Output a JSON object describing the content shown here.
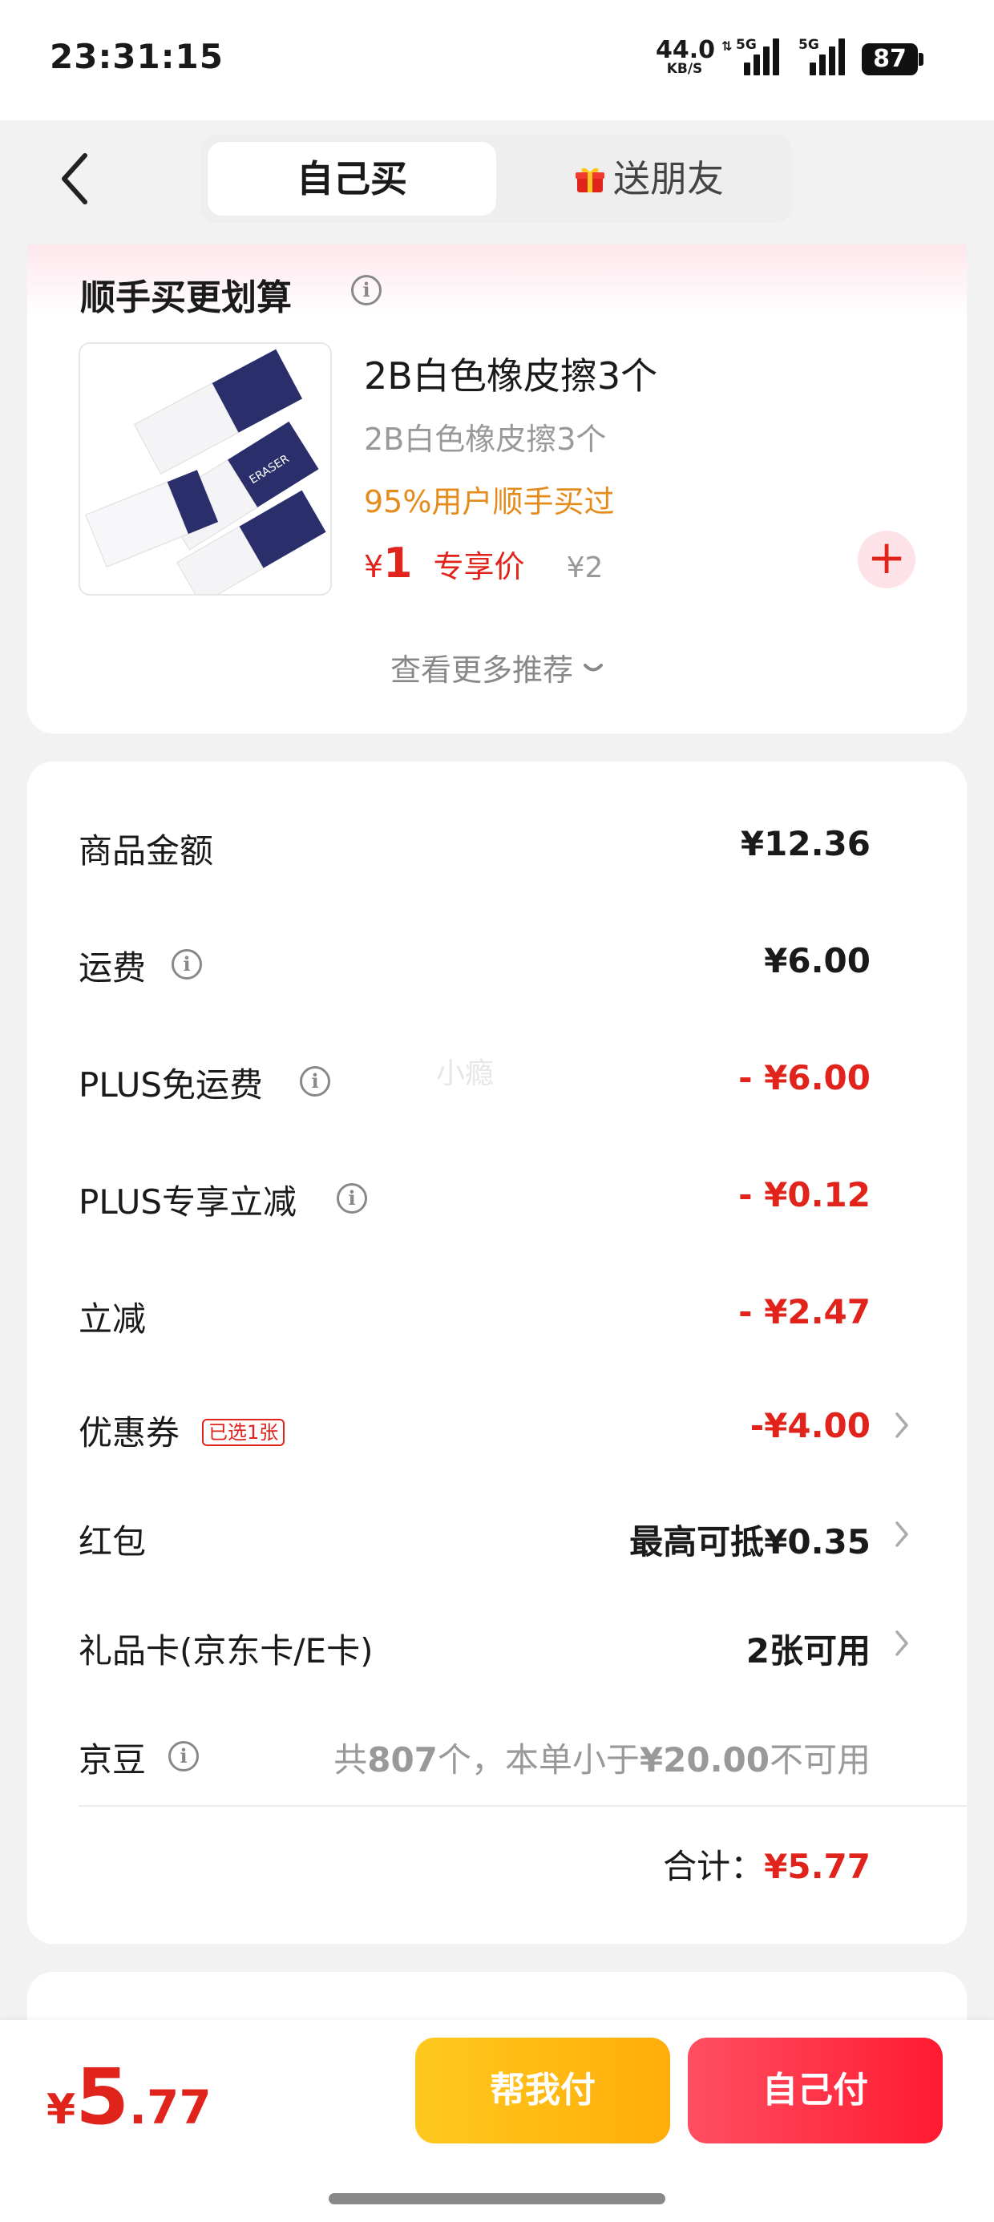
{
  "status_bar": {
    "time": "23:31:15",
    "net_speed_value": "44.0",
    "net_speed_unit": "KB/S",
    "sim1": "5G",
    "sim2": "5G",
    "battery": "87"
  },
  "nav": {
    "back_icon": "chevron-left-icon",
    "tabs": [
      {
        "label": "自己买",
        "active": true
      },
      {
        "label": "送朋友",
        "active": false,
        "icon": "gift-icon"
      }
    ]
  },
  "recommend": {
    "title": "顺手买更划算",
    "product": {
      "name": "2B白色橡皮擦3个",
      "subtitle": "2B白色橡皮擦3个",
      "social_proof": "95%用户顺手买过",
      "currency": "¥",
      "price": "1",
      "price_tag": "专享价",
      "original_price": "¥2"
    },
    "more_link": "查看更多推荐"
  },
  "details": {
    "rows": [
      {
        "label": "商品金额",
        "value": "¥12.36"
      },
      {
        "label": "运费",
        "value": "¥6.00"
      },
      {
        "label": "PLUS免运费",
        "value": "- ¥6.00"
      },
      {
        "label": "PLUS专享立减",
        "value": "- ¥0.12"
      },
      {
        "label": "立减",
        "value": "- ¥2.47"
      },
      {
        "label": "优惠券",
        "tag": "已选1张",
        "value": "-¥4.00"
      },
      {
        "label": "红包",
        "value": "最高可抵¥0.35"
      },
      {
        "label": "礼品卡(京东卡/E卡)",
        "value": "2张可用"
      },
      {
        "label": "京豆",
        "value_a": "共",
        "value_b": "807",
        "value_c": "个，本单小于",
        "value_d": "¥20.00",
        "value_e": "不可用"
      }
    ],
    "watermark": "小瘾",
    "total_label": "合计：",
    "total_value": "¥5.77"
  },
  "bottom": {
    "currency": "¥",
    "integer": "5",
    "decimal": ".77",
    "friend_pay": "帮我付",
    "self_pay": "自己付"
  },
  "colors": {
    "accent_red": "#e0231b",
    "social_orange": "#e48b1c",
    "friend_button": "#ffb612",
    "self_button": "#ff2a3f"
  }
}
